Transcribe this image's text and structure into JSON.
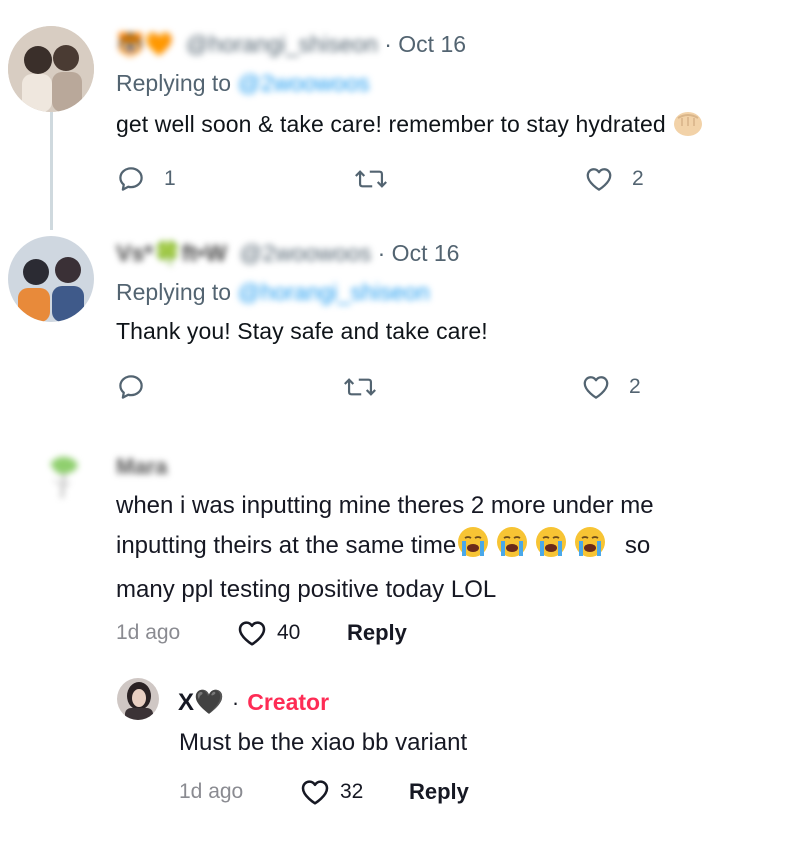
{
  "twitter": {
    "tweet1": {
      "display_name": "🐯🧡",
      "handle": "@horangi_shiseon",
      "date": "· Oct 16",
      "replying_label": "Replying to",
      "replying_handle": "@2woowoos",
      "text": "get well soon & take care! remember to stay hydrated",
      "reply_count": "1",
      "like_count": "2"
    },
    "tweet2": {
      "display_name": "Vs*🍀ft•W",
      "handle": "@2woowoos",
      "date": "· Oct 16",
      "replying_label": "Replying to",
      "replying_handle": "@horangi_shiseon",
      "text": "Thank you! Stay safe and take care!",
      "like_count": "2"
    }
  },
  "tiktok": {
    "comment": {
      "username": "Mara",
      "lines": [
        "when i was inputting mine theres 2 more under me",
        "inputting theirs at the same time",
        "many ppl testing positive today LOL"
      ],
      "line2_suffix": "so",
      "time": "1d ago",
      "likes": "40",
      "reply_label": "Reply"
    },
    "reply": {
      "username": "X🖤",
      "creator_label": "Creator",
      "separator": "·",
      "text": "Must be the xiao bb variant",
      "time": "1d ago",
      "likes": "32",
      "reply_label": "Reply"
    }
  },
  "colors": {
    "link": "#1d9bf0",
    "creator": "#fe2c55",
    "muted": "#536471"
  }
}
